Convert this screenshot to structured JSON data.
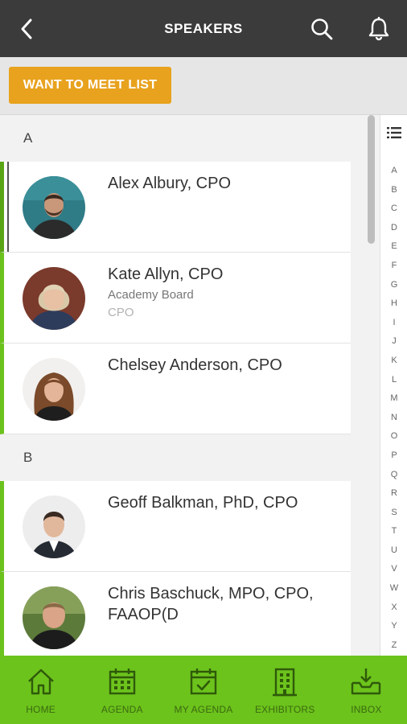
{
  "header": {
    "title": "SPEAKERS",
    "icons": [
      "back-arrow-icon",
      "search-icon",
      "bell-icon"
    ]
  },
  "toolbar": {
    "want_to_meet_label": "WANT TO MEET LIST",
    "accent_color": "#e8a21e"
  },
  "sections": [
    {
      "letter": "A",
      "speakers": [
        {
          "name": "Alex Albury, CPO",
          "line2": "",
          "line3": ""
        },
        {
          "name": "Kate Allyn, CPO",
          "line2": "Academy Board",
          "line3": "CPO"
        },
        {
          "name": "Chelsey Anderson, CPO",
          "line2": "",
          "line3": ""
        }
      ]
    },
    {
      "letter": "B",
      "speakers": [
        {
          "name": "Geoff Balkman, PhD, CPO",
          "line2": "",
          "line3": ""
        },
        {
          "name": "Chris Baschuck, MPO, CPO, FAAOP(D",
          "line2": "",
          "line3": ""
        }
      ]
    }
  ],
  "alphabet_index": [
    "A",
    "B",
    "C",
    "D",
    "E",
    "F",
    "G",
    "H",
    "I",
    "J",
    "K",
    "L",
    "M",
    "N",
    "O",
    "P",
    "Q",
    "R",
    "S",
    "T",
    "U",
    "V",
    "W",
    "X",
    "Y",
    "Z"
  ],
  "tabs": [
    {
      "label": "HOME",
      "icon": "home-icon"
    },
    {
      "label": "AGENDA",
      "icon": "calendar-icon"
    },
    {
      "label": "MY AGENDA",
      "icon": "calendar-check-icon"
    },
    {
      "label": "EXHIBITORS",
      "icon": "building-icon"
    },
    {
      "label": "INBOX",
      "icon": "inbox-download-icon"
    }
  ],
  "colors": {
    "header_bg": "#3b3b3b",
    "tabbar_bg": "#6cc31c",
    "card_accent": "#6cc21c"
  }
}
